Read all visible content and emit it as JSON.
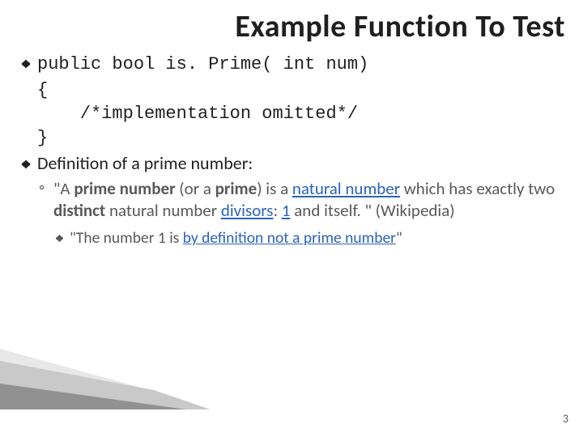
{
  "title": "Example Function To Test",
  "code": {
    "line1": "public bool is. Prime( int num)",
    "line2": "{",
    "line3": "    /*implementation omitted*/",
    "line4": "}"
  },
  "definition_label": "Definition of a prime number:",
  "quote": {
    "prefix": "\"A ",
    "prime_number_bold": "prime number",
    "mid1": " (or a ",
    "prime_bold": "prime",
    "mid2": ") is a ",
    "natural_number_link": "natural number",
    "mid3": " which has exactly two ",
    "distinct_bold": "distinct",
    "mid4": " natural number ",
    "divisors_link": "divisors",
    "colon": ": ",
    "one_link": "1",
    "end": " and itself. \" (Wikipedia)"
  },
  "sub_quote": {
    "prefix": "\"The number 1 is ",
    "by_def_link": "by definition not a prime number",
    "suffix": "\""
  },
  "page_number": "3"
}
